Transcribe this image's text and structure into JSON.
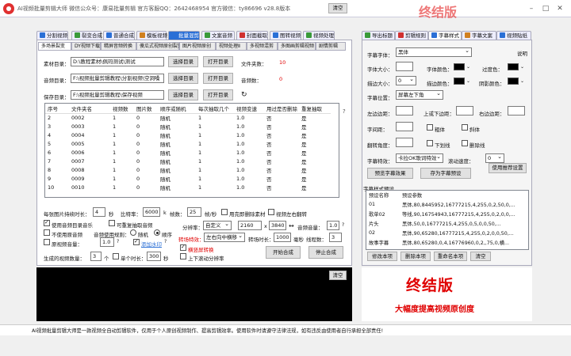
{
  "window": {
    "title": "AI视频批量剪辑大师    微信公众号：康易批量剪辑    官方客服QQ：2642468954    官方微信：ty86696    v28.8版本"
  },
  "top_right": {
    "clear_label": "清空",
    "overlay_title": "终结版"
  },
  "main_tabs": [
    "分割视频",
    "裂变合成",
    "普通合成",
    "模板视频",
    "批量混剪",
    "文案音频",
    "封面截取",
    "图转视频",
    "视频处理"
  ],
  "sub_tabs": [
    "多场景裂变",
    "DY视频下载",
    "精屏音频转换",
    "傻瓜式视频原创裂变",
    "图片视频原创",
    "视频处理Ⅱ",
    "多视频混剪",
    "多图画剪辑视频",
    "剧情剪辑"
  ],
  "material": {
    "material_dir_label": "素材目录：",
    "material_dir_value": "D:\\教程素材\\佩玛测试\\测试",
    "audio_dir_label": "音频目录：",
    "audio_dir_value": "F:\\视频批量剪辑教程\\分割视频\\空洞嗓",
    "save_dir_label": "保存目录：",
    "save_dir_value": "F:\\视频批量剪辑教程\\保存视频",
    "select_btn": "选择目录",
    "open_btn": "打开目录",
    "file_count_label": "文件夹数：",
    "file_count_value": "10",
    "audio_count_label": "音频数：",
    "audio_count_value": "0"
  },
  "table": {
    "headers": [
      "序号",
      "文件夹名",
      "视频数",
      "图片数",
      "顺序或随机",
      "每次抽取几个",
      "视频变速",
      "用过是否删除",
      "重复抽取"
    ],
    "rows": [
      [
        "2",
        "0002",
        "1",
        "0",
        "随机",
        "1",
        "1.0",
        "否",
        "是"
      ],
      [
        "3",
        "0003",
        "1",
        "0",
        "随机",
        "1",
        "1.0",
        "否",
        "是"
      ],
      [
        "4",
        "0004",
        "1",
        "0",
        "随机",
        "1",
        "1.0",
        "否",
        "是"
      ],
      [
        "5",
        "0005",
        "1",
        "0",
        "随机",
        "1",
        "1.0",
        "否",
        "是"
      ],
      [
        "6",
        "0006",
        "1",
        "0",
        "随机",
        "1",
        "1.0",
        "否",
        "是"
      ],
      [
        "7",
        "0007",
        "1",
        "0",
        "随机",
        "1",
        "1.0",
        "否",
        "是"
      ],
      [
        "8",
        "0008",
        "1",
        "0",
        "随机",
        "1",
        "1.0",
        "否",
        "是"
      ],
      [
        "9",
        "0009",
        "1",
        "0",
        "随机",
        "1",
        "1.0",
        "否",
        "是"
      ],
      [
        "10",
        "0010",
        "1",
        "0",
        "随机",
        "1",
        "1.0",
        "否",
        "是"
      ]
    ]
  },
  "settings": {
    "img_duration_label": "每张图片持续时长：",
    "img_duration_value": "4",
    "sec": "秒",
    "bitrate_label": "比特率：",
    "bitrate_value": "6000",
    "k": "k",
    "fps_label": "帧数：",
    "fps_value": "25",
    "fps_unit": "帧/秒",
    "used_delete": "用完即删除素材",
    "video_mirror": "视频左右翻转",
    "use_audio_dir": "使用音频目录音乐",
    "speed_change": "可重复抽取音频",
    "no_orig_audio": "不使用原音频",
    "audio_rule": "音频使用规则：",
    "random": "随机",
    "order": "顺序",
    "mute_video": "原视频音量：",
    "mute_value": "1.0",
    "watermark": "添加水印",
    "output_count_label": "生成的视频数量：",
    "output_count_value": "3",
    "output_unit": "个",
    "single_duration": "单个时长：",
    "single_duration_value": "300",
    "single_unit": "秒",
    "resolution_label": "分辨率：",
    "resolution_mode": "自定义",
    "res_w": "2160",
    "res_h": "3840",
    "volume_label": "音频音量：",
    "volume_value": "1.0",
    "transition_label": "转场特效：",
    "transition_value": "左右向中横移",
    "transition_time_label": "转场时长：",
    "transition_time_value": "1000",
    "ms": "毫秒",
    "threads_label": "线程数：",
    "threads_value": "3",
    "horizontal_mode": "横竖屏转换",
    "scroll_subtitle": "上下滚动分辨率",
    "start_btn": "开始合成",
    "stop_btn": "停止合成"
  },
  "log": {
    "clear_label": "清空"
  },
  "status_bar": "AI视频批量剪辑大师是一款视频全自动剪辑软件，仅用于个人原创视频制作、提高剪辑效率。使用软件时请遵守法律法规，如有违反由使用者自行承担全部责任!",
  "right_tabs": [
    "导出标题",
    "剪辑规则",
    "字幕样式",
    "字幕文案",
    "视频贴纸"
  ],
  "subtitle": {
    "font_label": "字幕字体：",
    "font_value": "黑体",
    "help_label": "说明",
    "size_label": "字体大小：",
    "color_label": "字体颜色：",
    "border_label": "过度色：",
    "outline_label": "描边大小：",
    "outline_value": "0",
    "outline_color_label": "描边颜色：",
    "shadow_color_label": "阴影颜色：",
    "position_label": "字幕位置：",
    "position_value": "屏幕左下角",
    "left_margin": "左边边距：",
    "top_margin": "上或下边距：",
    "right_margin": "右边边距：",
    "spacing_label": "字间距：",
    "bold": "粗体",
    "italic": "斜体",
    "angle_label": "翻转角度：",
    "underline": "下划线",
    "strike": "删除线",
    "effect_label": "字幕特效：",
    "effect_value": "卡拉OK歌词特效",
    "speed_label": "滚动速度：",
    "speed_value": "0",
    "preview_btn": "预览字幕效果",
    "save_btn": "存为字幕预设",
    "use_recommend_btn": "使用推荐设置",
    "preset_title": "字幕样式预设",
    "preset_headers": [
      "预设名称",
      "预设参数"
    ],
    "presets": [
      [
        "01",
        "黑体,80,8445952,16777215,4,255,0,2,50,0,..."
      ],
      [
        "歌单02",
        "等线,90,16754943,16777215,4,255,0,2,0,0,..."
      ],
      [
        "片头",
        "黑体,50,0,16777215,4,255,0,5,0,0,50,..."
      ],
      [
        "02",
        "黑体,90,65280,16777215,4,255,0,2,0,0,50,..."
      ],
      [
        "故事字幕",
        "黑体,80,65280,0,4,16776960,0,2,,75,0,横..."
      ]
    ],
    "modify_btn": "修改本项",
    "delete_btn": "删除本项",
    "rename_btn": "重命名本项",
    "clear_btn": "清空"
  },
  "promo": {
    "line1": "终结版",
    "line2": "大幅度提高视频原创度"
  },
  "colors": {
    "accent_red": "#e00000",
    "tab_blue": "#2a6fd6"
  }
}
